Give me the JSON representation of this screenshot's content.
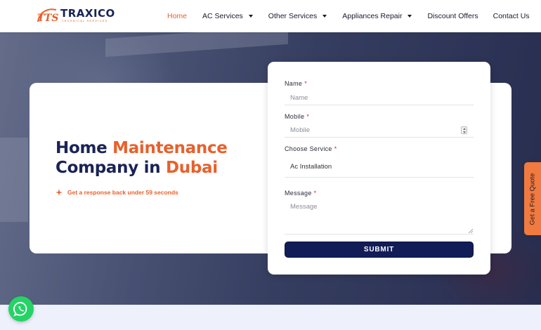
{
  "brand": {
    "mark": "TTS",
    "name": "TRAXICO",
    "tagline": "TECHNICAL SERVICES",
    "accent_color": "#e8602c",
    "navy_color": "#1a2356"
  },
  "nav": {
    "items": [
      {
        "label": "Home",
        "active": true,
        "has_dropdown": false
      },
      {
        "label": "AC Services",
        "active": false,
        "has_dropdown": true
      },
      {
        "label": "Other Services",
        "active": false,
        "has_dropdown": true
      },
      {
        "label": "Appliances Repair",
        "active": false,
        "has_dropdown": true
      },
      {
        "label": "Discount Offers",
        "active": false,
        "has_dropdown": false
      },
      {
        "label": "Contact Us",
        "active": false,
        "has_dropdown": false
      }
    ]
  },
  "hero": {
    "line1_a": "Home ",
    "line1_b": "Maintenance",
    "line2_a": "Company in ",
    "line2_b": "Dubai",
    "response_text": "Get a response back under 59 seconds",
    "response_icon": "sparkle-icon"
  },
  "form": {
    "name_label": "Name",
    "name_placeholder": "Name",
    "mobile_label": "Mobile",
    "mobile_placeholder": "Mobile",
    "service_label": "Choose Service",
    "service_value": "Ac Installation",
    "message_label": "Message",
    "message_placeholder": "Message",
    "required_mark": "*",
    "submit_label": "SUBMIT",
    "submit_color": "#121d57"
  },
  "quote_tab": {
    "label": "Get a Free Quote",
    "color": "#f07a3f"
  },
  "whatsapp": {
    "icon": "whatsapp-icon",
    "color": "#25d366"
  }
}
